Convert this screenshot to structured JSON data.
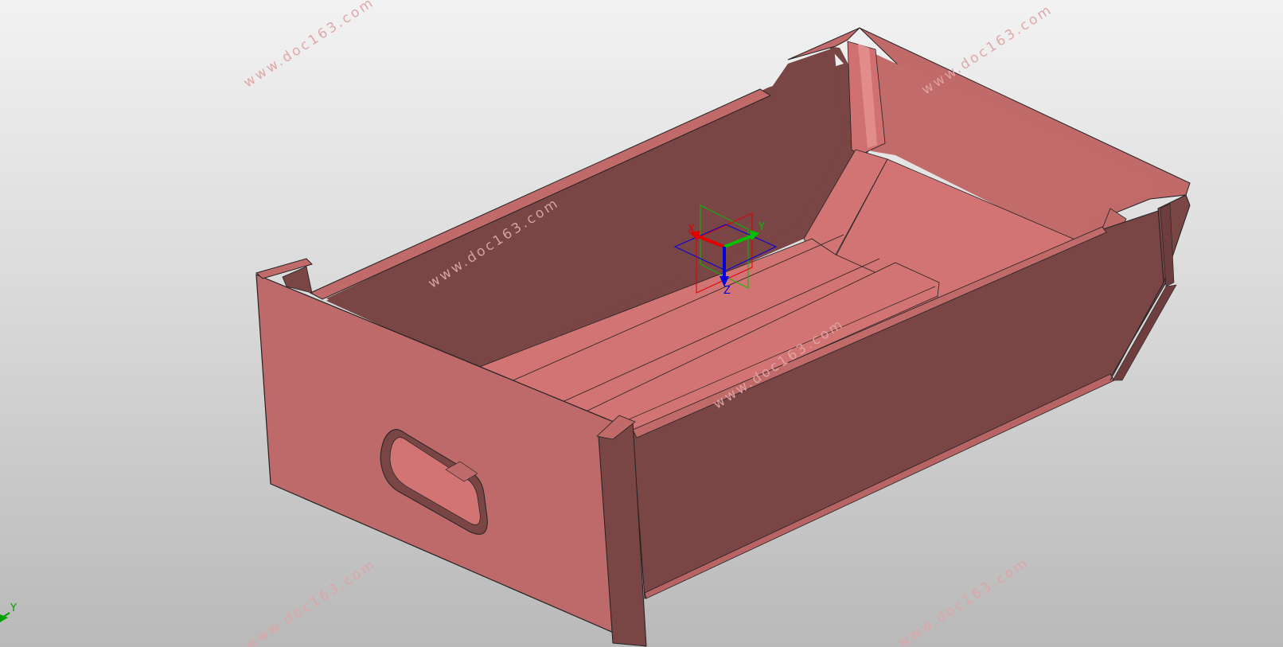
{
  "viewport": {
    "background_top": "#f2f2f2",
    "background_bottom": "#b9b9b9",
    "model_color": "#c06a6a",
    "model_shadow_color": "#7a4545",
    "model_highlight_color": "#d27474"
  },
  "watermarks": [
    {
      "text": "www.doc163.com"
    },
    {
      "text": "www.doc163.com"
    },
    {
      "text": "www.doc163.com"
    },
    {
      "text": "www.doc163.com"
    },
    {
      "text": "www.doc163.com"
    },
    {
      "text": "www.doc163.com"
    }
  ],
  "triad": {
    "x_label": "X",
    "y_label": "Y",
    "z_label": "Z",
    "x_color": "#e00000",
    "y_color": "#00c000",
    "z_color": "#0000e0"
  },
  "corner_axis": {
    "y_label": "Y",
    "color": "#00a000"
  }
}
